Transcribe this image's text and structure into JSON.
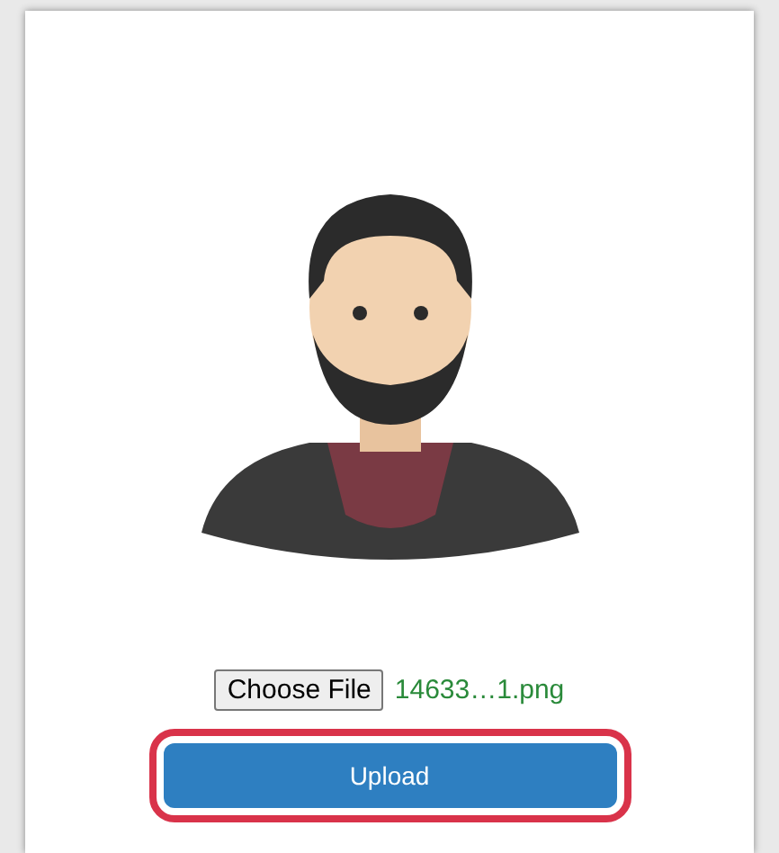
{
  "file_input": {
    "button_label": "Choose File",
    "file_name": "14633…1.png"
  },
  "upload_button": {
    "label": "Upload",
    "highlighted": true
  }
}
